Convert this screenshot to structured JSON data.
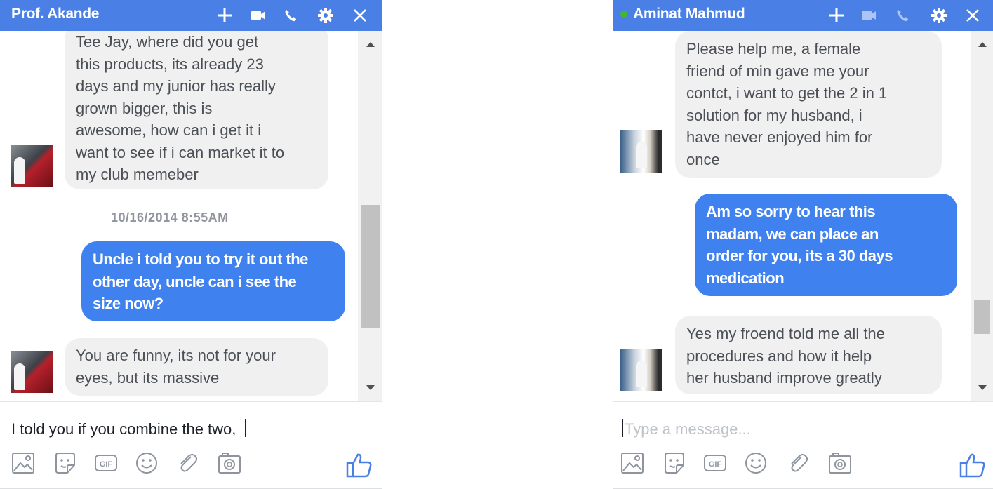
{
  "chats": {
    "left": {
      "contact_name": "Prof. Akande",
      "header_icons": [
        "plus-icon",
        "video-camera-icon",
        "phone-icon",
        "gear-icon",
        "close-icon"
      ],
      "messages": [
        {
          "direction": "incoming",
          "text": "Tee Jay, where did you get\nthis  products, its already 23\ndays and my junior has  really\ngrown bigger, this is\nawesome, how can i get it i\nwant to see if i can market it to\nmy club memeber"
        },
        {
          "type": "timestamp",
          "text": "10/16/2014 8:55AM"
        },
        {
          "direction": "outgoing",
          "text": "Uncle i told you to try it out the\nother day, uncle can i see the\nsize now?"
        },
        {
          "direction": "incoming",
          "text": "You are funny, its not for your\neyes, but its massive"
        }
      ],
      "composer": {
        "value": "I told you if you combine the two, ",
        "placeholder": ""
      },
      "toolbar_icons": [
        "image-icon",
        "sticker-icon",
        "gif-icon",
        "emoji-icon",
        "attachment-icon",
        "camera-icon"
      ],
      "like_icon": "thumbs-up-icon"
    },
    "right": {
      "contact_name": "Aminat Mahmud",
      "online": true,
      "header_icons": [
        "plus-icon",
        "video-camera-icon",
        "phone-icon",
        "gear-icon",
        "close-icon"
      ],
      "messages": [
        {
          "direction": "incoming",
          "text": "Please help me, a female\nfriend of min gave me your\ncontct, i want to get the  2 in 1\nsolution for my husband, i\nhave never enjoyed him for\nonce"
        },
        {
          "direction": "outgoing",
          "text": "Am so sorry to hear this\nmadam, we can place an\norder for you, its a 30 days\nmedication"
        },
        {
          "direction": "incoming",
          "text": "Yes my froend told me all the\nprocedures and how it help\nher husband improve greatly"
        }
      ],
      "composer": {
        "value": "",
        "placeholder": "Type a message..."
      },
      "toolbar_icons": [
        "image-icon",
        "sticker-icon",
        "gif-icon",
        "emoji-icon",
        "attachment-icon",
        "camera-icon"
      ],
      "like_icon": "thumbs-up-icon"
    }
  },
  "colors": {
    "header": "#4a80e6",
    "outgoing_bubble": "#3f82ef",
    "incoming_bubble": "#f0f0f0",
    "online_dot": "#42b72a",
    "like_icon": "#4a80e6"
  }
}
